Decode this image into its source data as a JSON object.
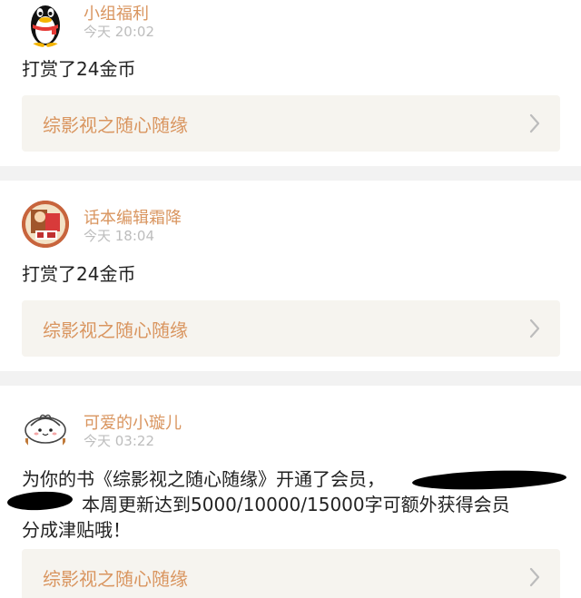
{
  "notifications": [
    {
      "username": "小组福利",
      "time": "今天 20:02",
      "message": "打赏了24金币",
      "book_title": "综影视之随心随缘",
      "avatar": "qq-penguin-avatar",
      "chevron_icon": "chevron-right-icon"
    },
    {
      "username": "话本编辑霜降",
      "time": "今天 18:04",
      "message": "打赏了24金币",
      "book_title": "综影视之随心随缘",
      "avatar": "editor-avatar",
      "chevron_icon": "chevron-right-icon"
    },
    {
      "username": "可爱的小璇儿",
      "time": "今天 03:22",
      "message_line1": "为你的书《综影视之随心随缘》开通了会员，",
      "message_line2": "本周更新达到5000/10000/15000字可额外获得会员",
      "message_line3": "分成津贴哦！",
      "book_title": "综影视之随心随缘",
      "avatar": "cartoon-bun-avatar",
      "chevron_icon": "chevron-right-icon"
    }
  ],
  "colors": {
    "accent": "#d9955f",
    "time_gray": "#bdbdbd",
    "link_bg": "#f6f4ef",
    "separator": "#f2f2f2",
    "text": "#222222"
  }
}
